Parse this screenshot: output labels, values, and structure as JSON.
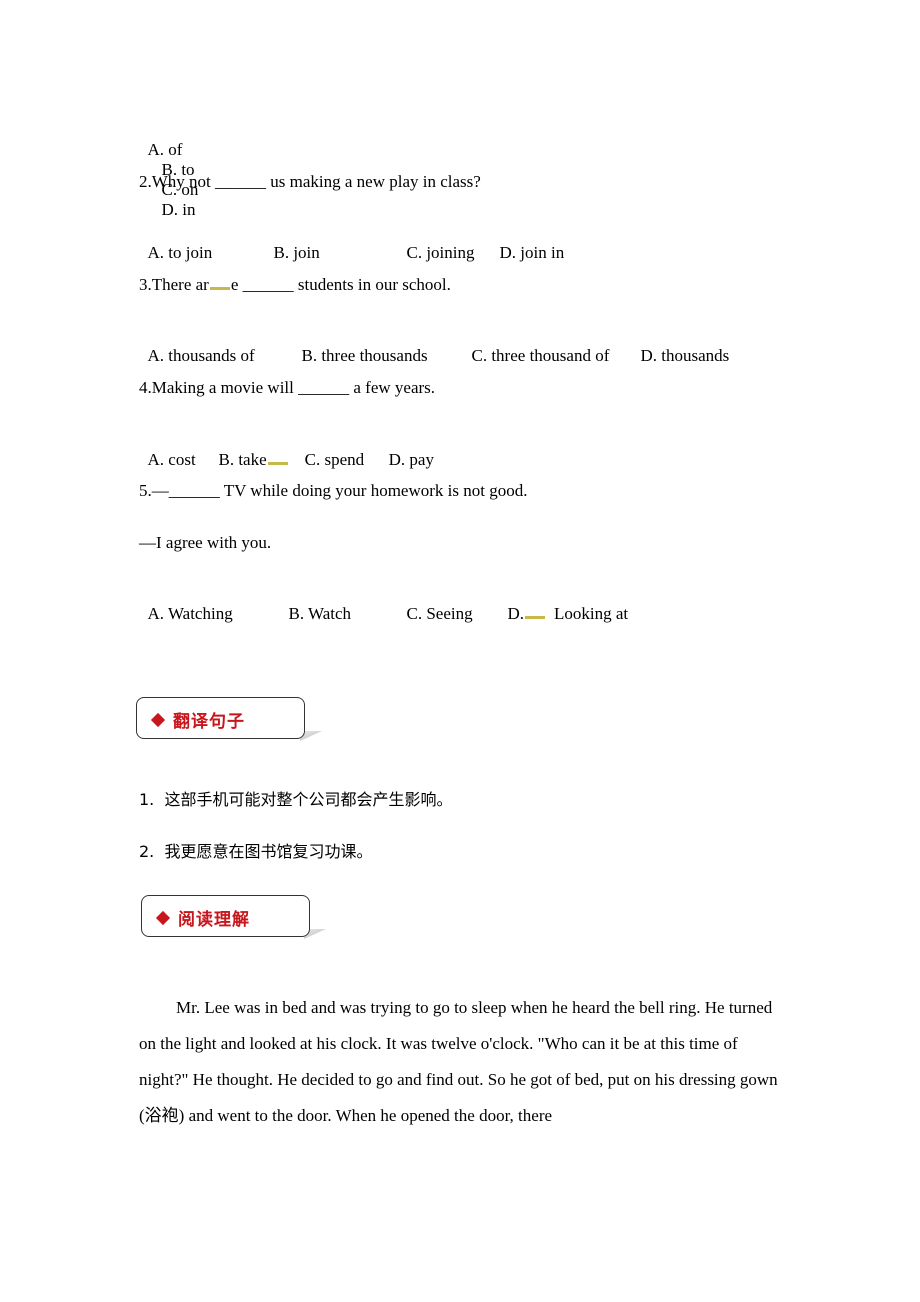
{
  "q1_options": [
    "A. of",
    "B. to",
    "C. on",
    "D. in"
  ],
  "q2": {
    "stem": "2.Why not ______ us making a new play in class?",
    "options": [
      "A. to join",
      "B. join",
      "C. joining",
      "D. join in"
    ]
  },
  "q3": {
    "stem_part1": "3.There ar",
    "stem_part2": "e ______ students in our school.",
    "options": [
      "A. thousands of",
      "B. three thousands",
      "C. three thousand of",
      "D. thousands"
    ]
  },
  "q4": {
    "stem": "4.Making a movie will ______ a few years.",
    "options": [
      "A. cost",
      "B. take",
      "C. spend",
      "D. pay"
    ]
  },
  "q5": {
    "stem": "5.—______ TV while doing your homework is not good.",
    "reply": "—I agree with you.",
    "options": [
      "A. Watching",
      "B. Watch",
      "C. Seeing",
      "D.",
      "Looking at"
    ]
  },
  "section_translate": {
    "title": "翻译句子",
    "items": [
      "1.  这部手机可能对整个公司都会产生影响。",
      "2.  我更愿意在图书馆复习功课。"
    ]
  },
  "section_reading": {
    "title": "阅读理解",
    "passage": "Mr. Lee was in bed and was trying to go to sleep when he heard the bell ring. He turned on the light and looked at his clock. It was twelve o'clock. \"Who can it be at this time of night?\" He thought. He decided to go and find out. So he got of bed, put on his dressing gown (浴袍) and went to the door. When he opened the door, there"
  },
  "colors": {
    "section_title": "#c8161d",
    "highlight_mark": "#c8b84a"
  }
}
